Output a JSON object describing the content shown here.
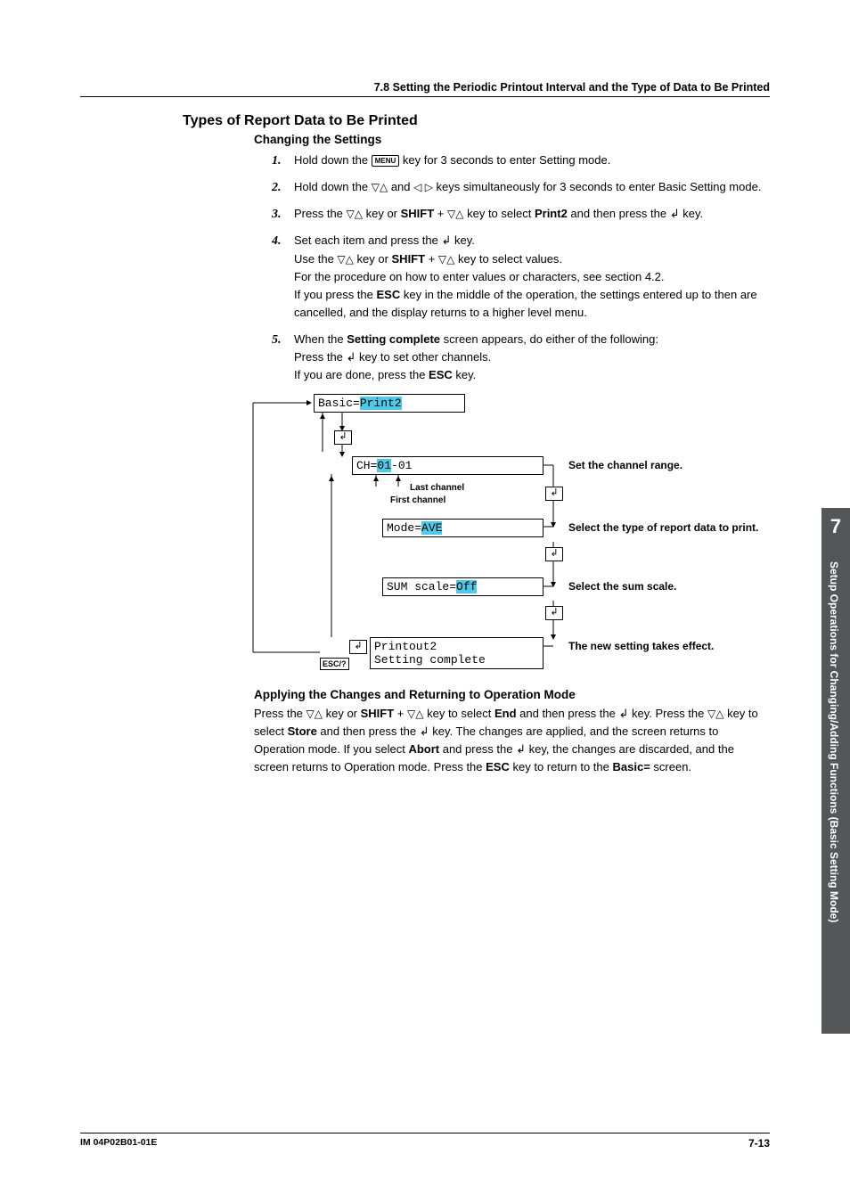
{
  "header": {
    "text": "7.8  Setting the Periodic Printout Interval and the Type of Data to Be Printed"
  },
  "titles": {
    "section": "Types of Report Data to Be Printed",
    "changing": "Changing the Settings",
    "applying": "Applying the Changes and Returning to Operation Mode"
  },
  "keys": {
    "menu": "MENU",
    "shift": "SHIFT",
    "esc": "ESC",
    "print2": "Print2",
    "setting_complete": "Setting complete",
    "end": "End",
    "store": "Store",
    "abort": "Abort",
    "basic_eq": "Basic="
  },
  "steps": {
    "s1a": "Hold down the ",
    "s1b": " key for 3 seconds to enter Setting mode.",
    "s2a": "Hold down the ",
    "s2b": " and ",
    "s2c": " keys simultaneously for 3 seconds to enter Basic Setting mode.",
    "s3a": "Press the ",
    "s3b": " key or ",
    "s3c": " + ",
    "s3d": " key to select ",
    "s3e": " and then press the ",
    "s3f": " key.",
    "s4a": "Set each item and press the ",
    "s4b": " key.",
    "s4c": "Use the ",
    "s4d": " key or ",
    "s4e": " + ",
    "s4f": " key to select values.",
    "s4g": "For the procedure on how to enter values or characters, see section 4.2.",
    "s4h": "If you press the ",
    "s4i": " key in the middle of the operation, the settings entered up to then are cancelled, and the display returns to a higher level menu.",
    "s5a": "When the ",
    "s5b": " screen appears, do either of the following:",
    "s5c": "Press the ",
    "s5d": " key to set other channels.",
    "s5e": "If you are done, press the ",
    "s5f": " key."
  },
  "diagram": {
    "basic_prefix": "Basic=",
    "basic_val": "Print2",
    "ch_prefix": "CH=",
    "ch_val1": "01",
    "ch_dash": "-01",
    "mode_prefix": "Mode=",
    "mode_val": "AVE",
    "sum_prefix": "SUM scale=",
    "sum_val": "Off",
    "printout2": "Printout2",
    "setting_complete": "Setting complete",
    "last_channel": "Last channel",
    "first_channel": "First channel",
    "esc_q": "ESC/?",
    "label_ch": "Set the channel range.",
    "label_mode": "Select the type of report data to print.",
    "label_sum": "Select the sum scale.",
    "label_done": "The new setting takes effect."
  },
  "apply": {
    "p1": "Press the ",
    "p2": " key or ",
    "p3": " + ",
    "p4": " key to select ",
    "p5": " and then press the ",
    "p6": " key. Press the ",
    "p7": " key to select ",
    "p8": " and then press the ",
    "p9": " key. The changes are applied, and the screen returns to Operation mode. If you select ",
    "p10": " and press the ",
    "p11": " key, the changes are discarded, and the screen returns to Operation mode. Press the ",
    "p12": " key to return to the ",
    "p13": " screen."
  },
  "sidebar": {
    "num": "7",
    "text": "Setup Operations for Changing/Adding Functions (Basic Setting Mode)"
  },
  "footer": {
    "left": "IM 04P02B01-01E",
    "right": "7-13"
  }
}
